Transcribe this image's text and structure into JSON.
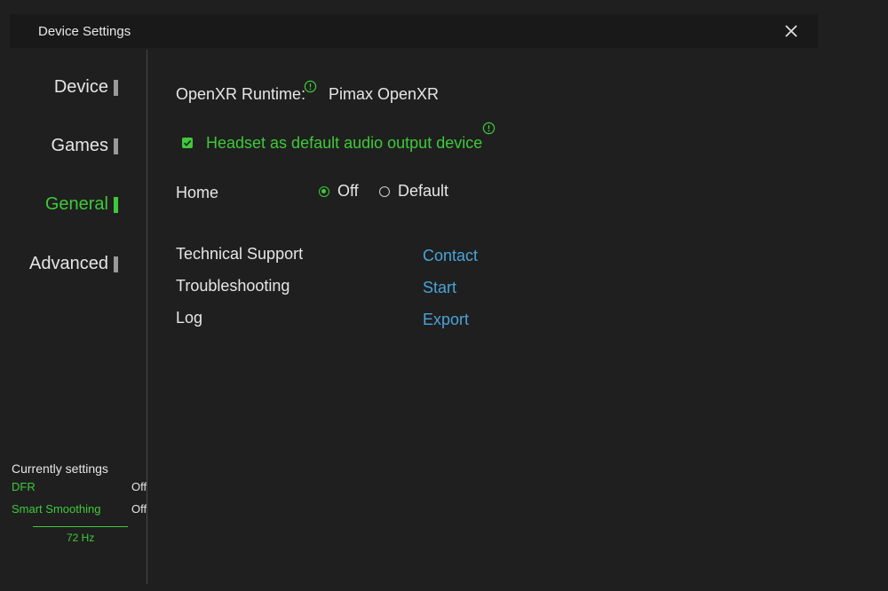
{
  "window": {
    "title": "Device Settings",
    "close_icon": "close-icon"
  },
  "sidebar": {
    "items": [
      {
        "label": "Device",
        "active": false
      },
      {
        "label": "Games",
        "active": false
      },
      {
        "label": "General",
        "active": true
      },
      {
        "label": "Advanced",
        "active": false
      }
    ],
    "current_settings": {
      "title": "Currently settings",
      "rows": [
        {
          "key": "DFR",
          "value": "Off"
        },
        {
          "key": "Smart Smoothing",
          "value": "Off"
        }
      ],
      "refresh_rate": "72 Hz"
    }
  },
  "general": {
    "openxr_label": "OpenXR Runtime:",
    "openxr_value": "Pimax OpenXR",
    "audio_checkbox": {
      "label": "Headset as default audio output device",
      "checked": true
    },
    "home": {
      "label": "Home",
      "options": [
        {
          "label": "Off",
          "selected": true
        },
        {
          "label": "Default",
          "selected": false
        }
      ]
    },
    "support_rows": [
      {
        "label": "Technical Support",
        "action": "Contact"
      },
      {
        "label": "Troubleshooting",
        "action": "Start"
      },
      {
        "label": "Log",
        "action": "Export"
      }
    ]
  },
  "colors": {
    "accent": "#3ec93a",
    "link": "#4aa3d8",
    "background": "#1f1f1f",
    "titlebar": "#191919"
  }
}
